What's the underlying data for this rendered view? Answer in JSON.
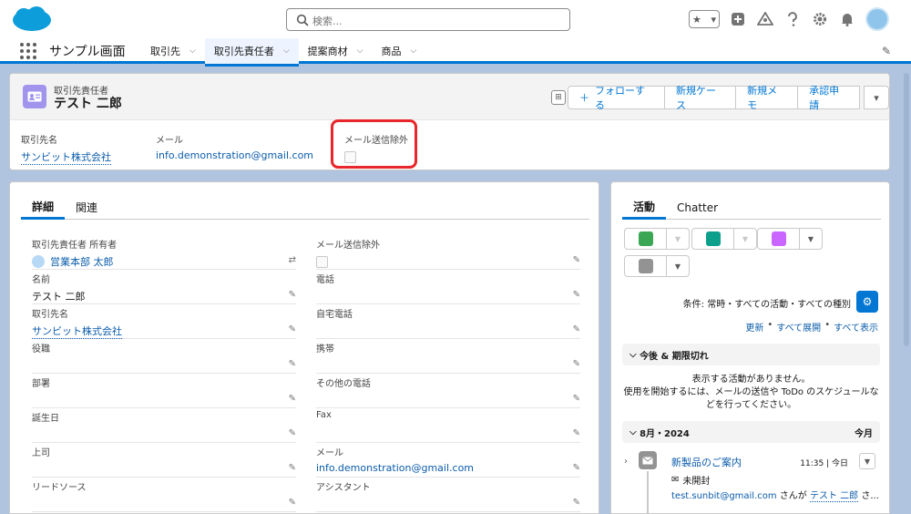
{
  "header": {
    "search_placeholder": "検索...",
    "fav_star": "★",
    "fav_chev": "▾"
  },
  "app_nav": {
    "app_name": "サンプル画面",
    "tabs": [
      {
        "label": "取引先"
      },
      {
        "label": "取引先責任者",
        "active": true
      },
      {
        "label": "提案商材"
      },
      {
        "label": "商品"
      }
    ]
  },
  "record": {
    "type_label": "取引先責任者",
    "name": "テスト 二郎",
    "buttons": {
      "follow": "フォローする",
      "new_case": "新規ケース",
      "new_memo": "新規メモ",
      "approval": "承認申請"
    },
    "highlights": {
      "account_label": "取引先名",
      "account_value": "サンビット株式会社",
      "email_label": "メール",
      "email_value": "info.demonstration@gmail.com",
      "opt_out_label": "メール送信除外"
    }
  },
  "details": {
    "tabs": {
      "detail": "詳細",
      "related": "関連"
    },
    "left": [
      {
        "label": "取引先責任者 所有者",
        "value": "営業本部 太郎"
      },
      {
        "label": "名前",
        "value": "テスト 二郎"
      },
      {
        "label": "取引先名",
        "value": "サンビット株式会社"
      },
      {
        "label": "役職",
        "value": ""
      },
      {
        "label": "部署",
        "value": ""
      },
      {
        "label": "誕生日",
        "value": ""
      },
      {
        "label": "上司",
        "value": ""
      },
      {
        "label": "リードソース",
        "value": ""
      }
    ],
    "right": [
      {
        "label": "メール送信除外",
        "value": ""
      },
      {
        "label": "電話",
        "value": ""
      },
      {
        "label": "自宅電話",
        "value": ""
      },
      {
        "label": "携帯",
        "value": ""
      },
      {
        "label": "その他の電話",
        "value": ""
      },
      {
        "label": "Fax",
        "value": ""
      },
      {
        "label": "メール",
        "value": "info.demonstration@gmail.com"
      },
      {
        "label": "アシスタント",
        "value": ""
      }
    ]
  },
  "activity": {
    "tabs": {
      "activity": "活動",
      "chatter": "Chatter"
    },
    "filter_text": "条件: 常時・すべての活動・すべての種別",
    "links": {
      "refresh": "更新",
      "expand": "すべて展開",
      "show_all": "すべて表示",
      "sep": "•"
    },
    "upcoming_label": "今後 & 期限切れ",
    "empty_line1": "表示する活動がありません。",
    "empty_line2": "使用を開始するには、メールの送信や ToDo のスケジュールな",
    "empty_line3": "どを行ってください。",
    "month_label": "8月・2024",
    "month_right": "今月",
    "item": {
      "title": "新製品のご案内",
      "time": "11:35 | 今日",
      "status": "未開封",
      "sender_email": "test.sunbit@gmail.com",
      "sender_mid": " さんが ",
      "sender_name": "テスト 二郎",
      "sender_end": " さ..."
    }
  },
  "colors": {
    "brand": "#0176d3",
    "highlight_box": "#e8262b",
    "contact_icon": "#a094ed"
  }
}
